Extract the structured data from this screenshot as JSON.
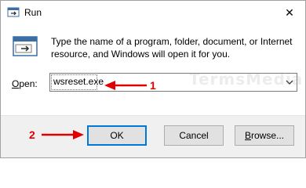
{
  "window": {
    "title": "Run",
    "close_glyph": "✕"
  },
  "body": {
    "description": "Type the name of a program, folder, document, or Internet resource, and Windows will open it for you.",
    "open_label_mnemonic": "O",
    "open_label_rest": "pen:",
    "input_value": "wsreset.exe",
    "watermark": "TermsMedia"
  },
  "buttons": {
    "ok": "OK",
    "cancel": "Cancel",
    "browse_mnemonic": "B",
    "browse_rest": "rowse..."
  },
  "annotations": {
    "step1": "1",
    "step2": "2",
    "arrow_color": "#e00000"
  },
  "icons": {
    "app": "run-app-icon",
    "run": "run-dialog-icon",
    "close": "close-icon",
    "chevron": "chevron-down-icon"
  },
  "colors": {
    "focus_border": "#0078d7",
    "footer_bg": "#f0f0f0"
  }
}
